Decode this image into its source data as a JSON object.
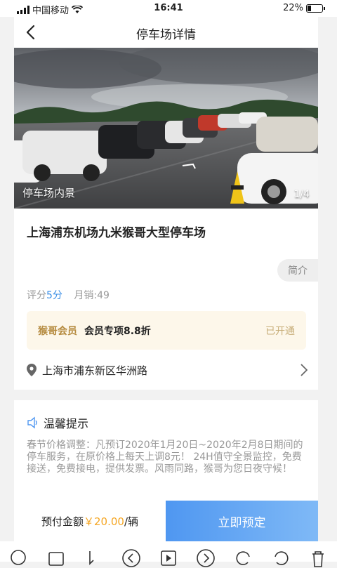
{
  "status_bar": {
    "carrier": "中国移动",
    "time": "16:41",
    "battery": "22%"
  },
  "nav": {
    "title": "停车场详情"
  },
  "gallery": {
    "label": "停车场内景",
    "counter": "1/4"
  },
  "lot": {
    "name": "上海浦东机场九米猴哥大型停车场",
    "intro_label": "简介",
    "rating_label": "评分",
    "rating_value": "5分",
    "sales": "月销:49"
  },
  "membership": {
    "brand": "猴哥会员",
    "offer": "会员专项8.8折",
    "status": "已开通"
  },
  "address": "上海市浦东新区华洲路",
  "tips": {
    "title": "温馨提示",
    "body": "春节价格调整：凡预订2020年1月20日~2020年2月8日期间的停车服务，在原价格上每天上调8元！ 24H值守全景监控，免费接送，免费接电，提供发票。风雨同路，猴哥为您日夜守候！"
  },
  "footer": {
    "pay_label": "预付金额",
    "price": "￥20.00",
    "unit": "/辆",
    "reserve": "立即预定"
  },
  "colors": {
    "accent": "#4f97f1",
    "price": "#f5a623",
    "gold": "#b58a3e"
  }
}
